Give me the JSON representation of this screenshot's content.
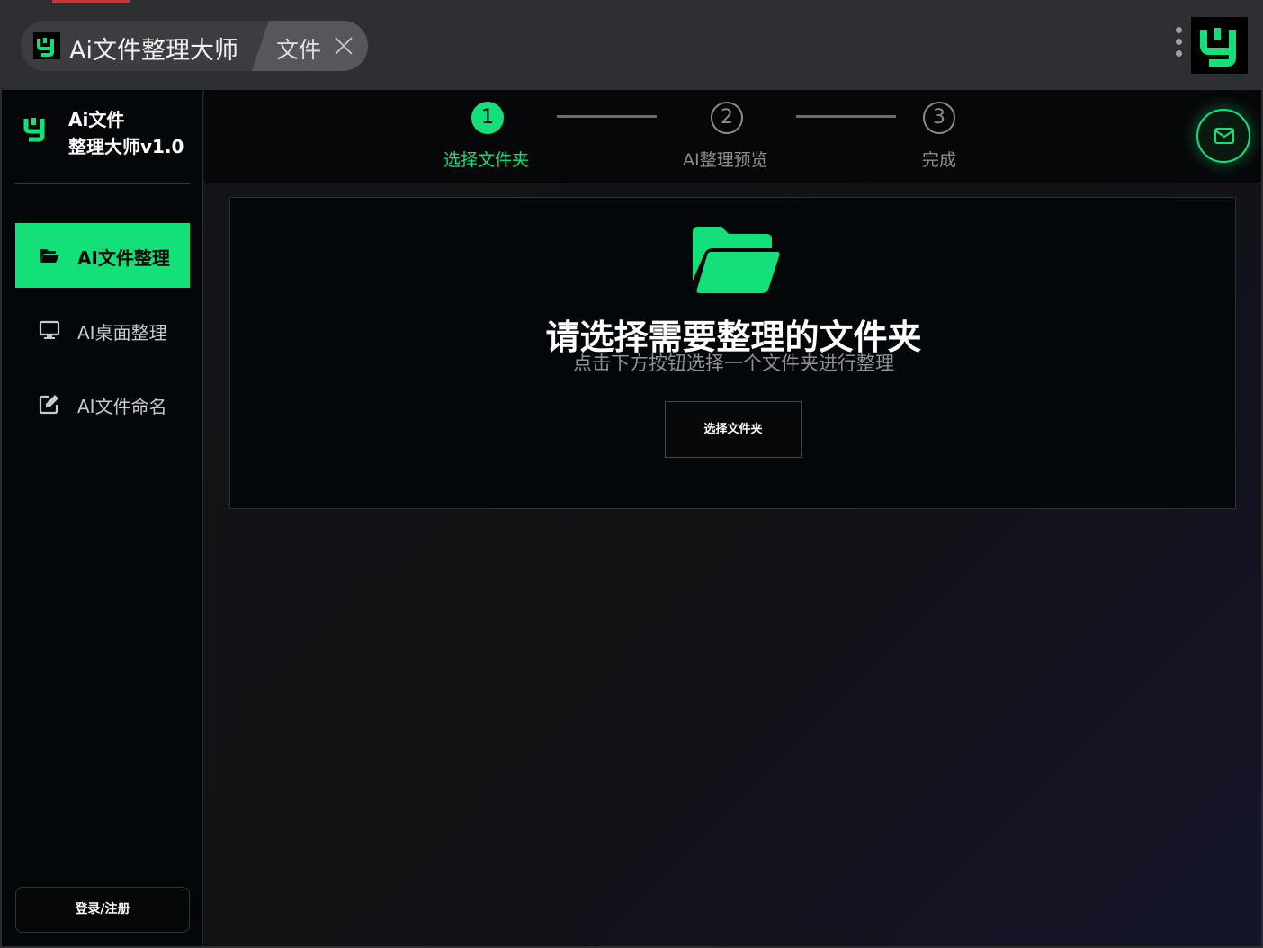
{
  "titlebar": {
    "tab_active_title": "Ai文件整理大师",
    "tab_second_title": "文件"
  },
  "sidebar": {
    "brand_line1": "Ai文件",
    "brand_line2": "整理大师v1.0",
    "items": [
      {
        "label": "AI文件整理",
        "icon": "folder-open-icon",
        "active": true
      },
      {
        "label": "AI桌面整理",
        "icon": "desktop-icon",
        "active": false
      },
      {
        "label": "AI文件命名",
        "icon": "edit-icon",
        "active": false
      }
    ],
    "login_label": "登录/注册"
  },
  "steps": [
    {
      "number": "1",
      "label": "选择文件夹",
      "state": "active"
    },
    {
      "number": "2",
      "label": "AI整理预览",
      "state": "pending"
    },
    {
      "number": "3",
      "label": "完成",
      "state": "pending"
    }
  ],
  "main": {
    "title": "请选择需要整理的文件夹",
    "subtitle": "点击下方按钮选择一个文件夹进行整理",
    "select_button": "选择文件夹"
  },
  "colors": {
    "accent": "#14e079",
    "background": "#111214",
    "sidebar_bg": "#040709"
  }
}
